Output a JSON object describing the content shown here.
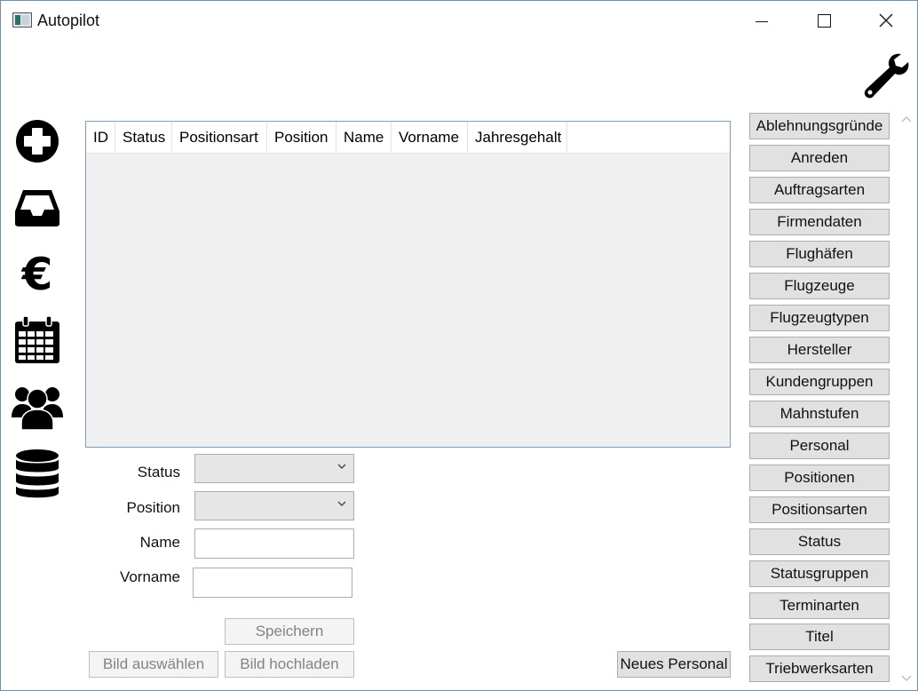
{
  "window": {
    "title": "Autopilot"
  },
  "grid": {
    "columns": [
      "ID",
      "Status",
      "Positionsart",
      "Position",
      "Name",
      "Vorname",
      "Jahresgehalt"
    ]
  },
  "form": {
    "status_label": "Status",
    "position_label": "Position",
    "name_label": "Name",
    "vorname_label": "Vorname",
    "status_value": "",
    "position_value": "",
    "name_value": "",
    "vorname_value": "",
    "save_label": "Speichern",
    "select_image_label": "Bild auswählen",
    "upload_image_label": "Bild hochladen",
    "new_personal_label": "Neues Personal"
  },
  "sidebar": {
    "items": [
      "Ablehnungsgründe",
      "Anreden",
      "Auftragsarten",
      "Firmendaten",
      "Flughäfen",
      "Flugzeuge",
      "Flugzeugtypen",
      "Hersteller",
      "Kundengruppen",
      "Mahnstufen",
      "Personal",
      "Positionen",
      "Positionsarten",
      "Status",
      "Statusgruppen",
      "Terminarten",
      "Titel",
      "Triebwerksarten"
    ]
  },
  "nav_icons": [
    "add-circle-icon",
    "inbox-icon",
    "euro-icon",
    "calendar-icon",
    "users-icon",
    "database-icon"
  ],
  "colors": {
    "accent_border": "#7f9db9",
    "button_bg": "#e1e1e1",
    "grid_bg": "#f0f0f0"
  }
}
